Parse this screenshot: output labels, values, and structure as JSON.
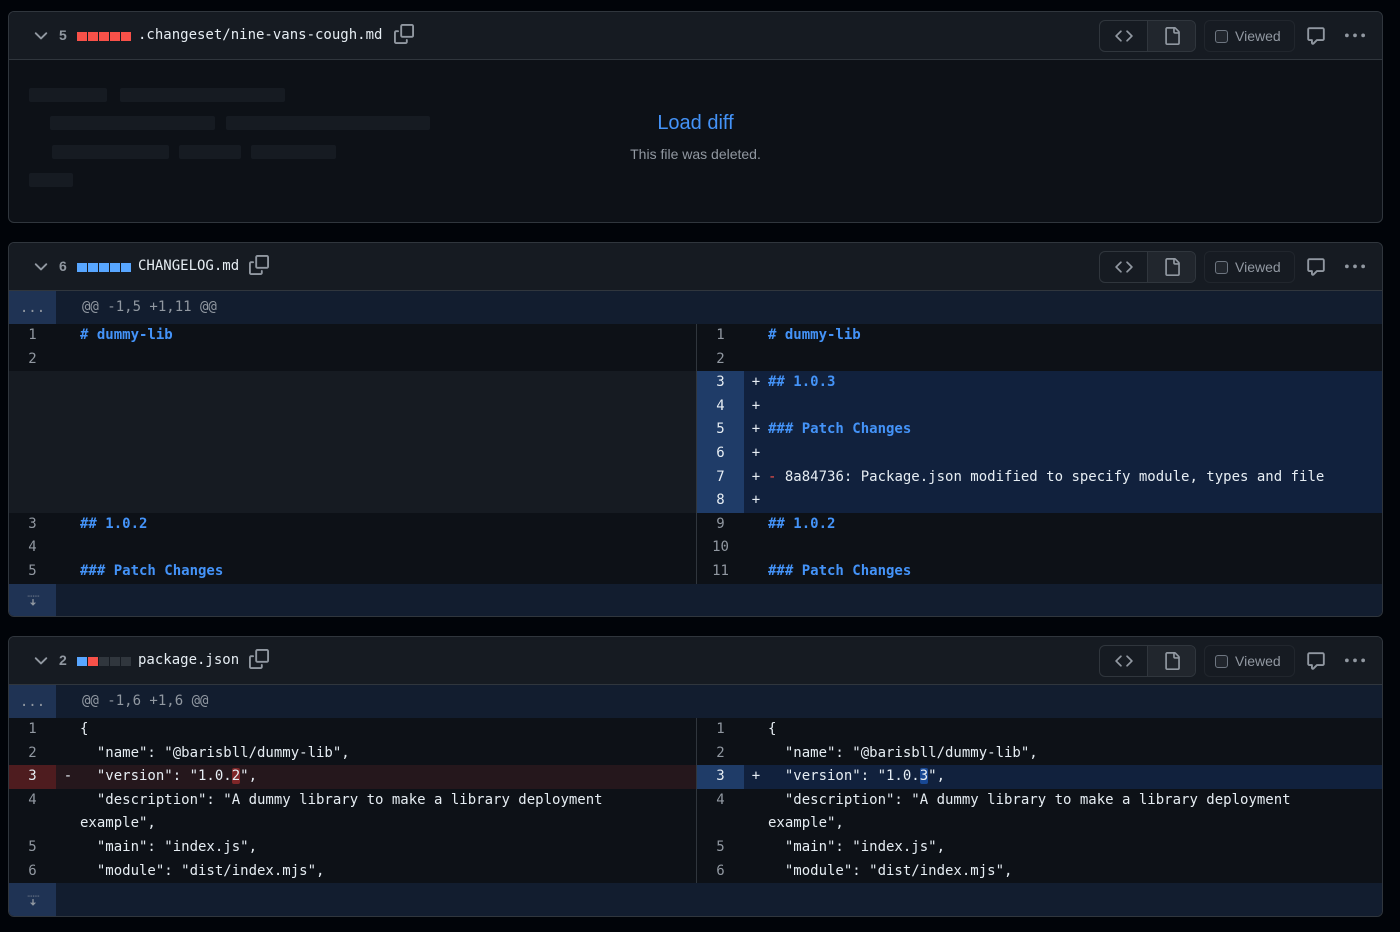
{
  "colors": {
    "added": "#58a6ff",
    "deleted": "#f85149",
    "neutral": "#30363d",
    "link": "#4493f8"
  },
  "files": [
    {
      "change_count": "5",
      "diffstat": [
        "deleted",
        "deleted",
        "deleted",
        "deleted",
        "deleted"
      ],
      "name": ".changeset/nine-vans-cough.md",
      "viewed_label": "Viewed",
      "load_link": "Load diff",
      "load_message": "This file was deleted."
    },
    {
      "change_count": "6",
      "diffstat": [
        "added",
        "added",
        "added",
        "added",
        "added"
      ],
      "name": "CHANGELOG.md",
      "viewed_label": "Viewed",
      "hunk": "@@ -1,5 +1,11 @@",
      "expand_glyph": "...",
      "rows": [
        {
          "l": {
            "n": "1",
            "c": "# dummy-lib",
            "t": "ctx"
          },
          "r": {
            "n": "1",
            "c": "# dummy-lib",
            "t": "ctx"
          },
          "heading": true
        },
        {
          "l": {
            "n": "2",
            "c": "",
            "t": "ctx"
          },
          "r": {
            "n": "2",
            "c": "",
            "t": "ctx"
          }
        },
        {
          "l": null,
          "r": {
            "n": "3",
            "m": "+",
            "c": "## 1.0.3",
            "t": "add"
          },
          "heading": true
        },
        {
          "l": null,
          "r": {
            "n": "4",
            "m": "+",
            "c": "",
            "t": "add"
          }
        },
        {
          "l": null,
          "r": {
            "n": "5",
            "m": "+",
            "c": "### Patch Changes",
            "t": "add"
          },
          "heading": true
        },
        {
          "l": null,
          "r": {
            "n": "6",
            "m": "+",
            "c": "",
            "t": "add"
          }
        },
        {
          "l": null,
          "r": {
            "n": "7",
            "m": "+",
            "bullet": "-",
            "c": " 8a84736: Package.json modified to specify module, types and file",
            "t": "add"
          }
        },
        {
          "l": null,
          "r": {
            "n": "8",
            "m": "+",
            "c": "",
            "t": "add"
          }
        },
        {
          "l": {
            "n": "3",
            "c": "## 1.0.2",
            "t": "ctx"
          },
          "r": {
            "n": "9",
            "c": "## 1.0.2",
            "t": "ctx"
          },
          "heading": true
        },
        {
          "l": {
            "n": "4",
            "c": "",
            "t": "ctx"
          },
          "r": {
            "n": "10",
            "c": "",
            "t": "ctx"
          }
        },
        {
          "l": {
            "n": "5",
            "c": "### Patch Changes",
            "t": "ctx"
          },
          "r": {
            "n": "11",
            "c": "### Patch Changes",
            "t": "ctx"
          },
          "heading": true
        }
      ]
    },
    {
      "change_count": "2",
      "diffstat": [
        "added",
        "deleted",
        "neutral",
        "neutral",
        "neutral"
      ],
      "name": "package.json",
      "viewed_label": "Viewed",
      "hunk": "@@ -1,6 +1,6 @@",
      "expand_glyph": "...",
      "rows": [
        {
          "l": {
            "n": "1",
            "c": "{",
            "t": "ctx"
          },
          "r": {
            "n": "1",
            "c": "{",
            "t": "ctx"
          }
        },
        {
          "l": {
            "n": "2",
            "c": "  \"name\": \"@barisbll/dummy-lib\",",
            "t": "ctx"
          },
          "r": {
            "n": "2",
            "c": "  \"name\": \"@barisbll/dummy-lib\",",
            "t": "ctx"
          }
        },
        {
          "l": {
            "n": "3",
            "m": "-",
            "pre": "  \"version\": \"1.0.",
            "w": "2",
            "post": "\",",
            "t": "del"
          },
          "r": {
            "n": "3",
            "m": "+",
            "pre": "  \"version\": \"1.0.",
            "w": "3",
            "post": "\",",
            "t": "add"
          }
        },
        {
          "l": {
            "n": "4",
            "c": "  \"description\": \"A dummy library to make a library deployment example\",",
            "t": "ctx"
          },
          "r": {
            "n": "4",
            "c": "  \"description\": \"A dummy library to make a library deployment example\",",
            "t": "ctx"
          }
        },
        {
          "l": {
            "n": "5",
            "c": "  \"main\": \"index.js\",",
            "t": "ctx"
          },
          "r": {
            "n": "5",
            "c": "  \"main\": \"index.js\",",
            "t": "ctx"
          }
        },
        {
          "l": {
            "n": "6",
            "c": "  \"module\": \"dist/index.mjs\",",
            "t": "ctx"
          },
          "r": {
            "n": "6",
            "c": "  \"module\": \"dist/index.mjs\",",
            "t": "ctx"
          }
        }
      ]
    }
  ]
}
